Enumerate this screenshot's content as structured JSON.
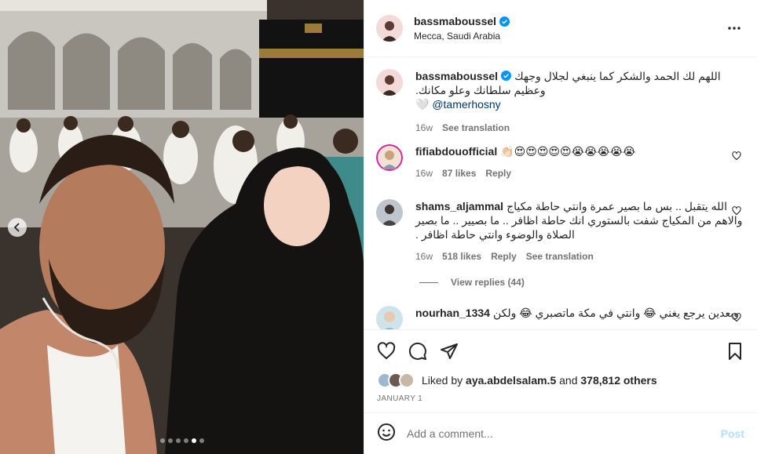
{
  "post": {
    "author": "bassmaboussel",
    "location": "Mecca, Saudi Arabia",
    "caption": {
      "text": "اللهم لك الحمد والشكر كما ينبغي لجلال وجهك وعظيم سلطانك وعلو مكانك.",
      "icon": "🤍",
      "mention": "@tamerhosny",
      "time": "16w",
      "see_translation": "See translation"
    },
    "carousel": {
      "total": 6,
      "active": 5
    }
  },
  "comments": [
    {
      "user": "fifiabdouofficial",
      "text": "👏🏻😍😍😍😍😍😭😭😭😭😭",
      "time": "16w",
      "likes": "87 likes",
      "reply": "Reply"
    },
    {
      "user": "shams_aljammal",
      "text": "الله يتقبل .. بس ما بصير عمرة وانتي حاطة مكياج والاهم من المكياج شفت بالستوري انك حاطة اظافر .. ما بصيير .. ما بصير الصلاة والوضوء وانتي حاطة اظافر .",
      "time": "16w",
      "likes": "518 likes",
      "reply": "Reply",
      "see_translation": "See translation",
      "view_replies": "View replies (44)"
    },
    {
      "user": "nourhan_1334",
      "text": "وبعدين يرجع يغني 😂 وانتي في مكة ماتصبري 😂 ولكن"
    }
  ],
  "likes": {
    "prefix": "Liked by",
    "user": "aya.abdelsalam.5",
    "middle": "and",
    "count": "378,812 others"
  },
  "date": "JANUARY 1",
  "composer": {
    "placeholder": "Add a comment...",
    "post_label": "Post"
  },
  "colors": {
    "verified": "#0095f6",
    "post_disabled": "#b2dffc",
    "text_secondary": "#737373"
  }
}
